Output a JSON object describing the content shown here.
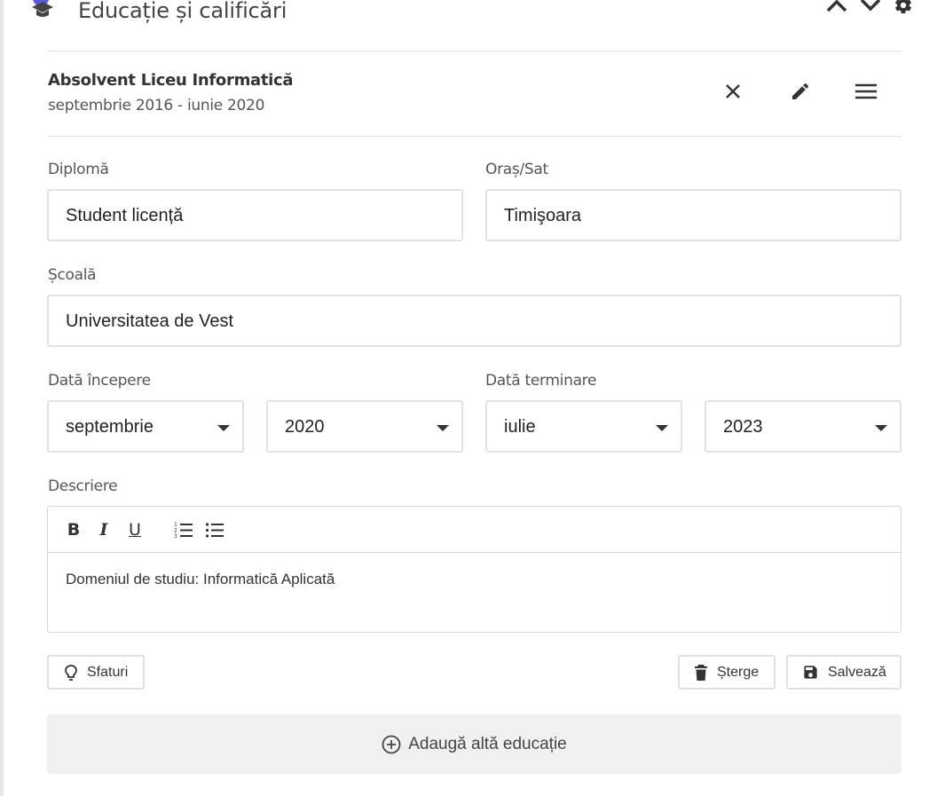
{
  "section": {
    "title": "Educație și calificări",
    "icons": {
      "section": "graduation-cap-icon",
      "up": "chevron-up-icon",
      "down": "chevron-down-icon",
      "settings": "gear-icon"
    }
  },
  "entry": {
    "title": "Absolvent Liceu Informatică",
    "dates": "septembrie 2016 - iunie 2020",
    "icons": {
      "close": "close-icon",
      "edit": "pencil-icon",
      "reorder": "menu-icon"
    }
  },
  "form": {
    "degree": {
      "label": "Diplomă",
      "value": "Student licență"
    },
    "city": {
      "label": "Oraș/Sat",
      "value": "Timişoara"
    },
    "school": {
      "label": "Școală",
      "value": "Universitatea de Vest"
    },
    "start_date": {
      "label": "Dată începere",
      "month": "septembrie",
      "year": "2020"
    },
    "end_date": {
      "label": "Dată terminare",
      "month": "iulie",
      "year": "2023"
    },
    "description": {
      "label": "Descriere",
      "toolbar": {
        "bold": "B",
        "italic": "I",
        "underline": "U"
      },
      "text": "Domeniul de studiu: Informatică Aplicată"
    }
  },
  "actions": {
    "tips": "Sfaturi",
    "delete": "Șterge",
    "save": "Salvează",
    "add_more": "Adaugă altă educație"
  },
  "colors": {
    "accent_icon": "#5b5bd6",
    "text": "#333333",
    "border": "#e2e2e2",
    "add_bg": "#f0f0f0"
  }
}
